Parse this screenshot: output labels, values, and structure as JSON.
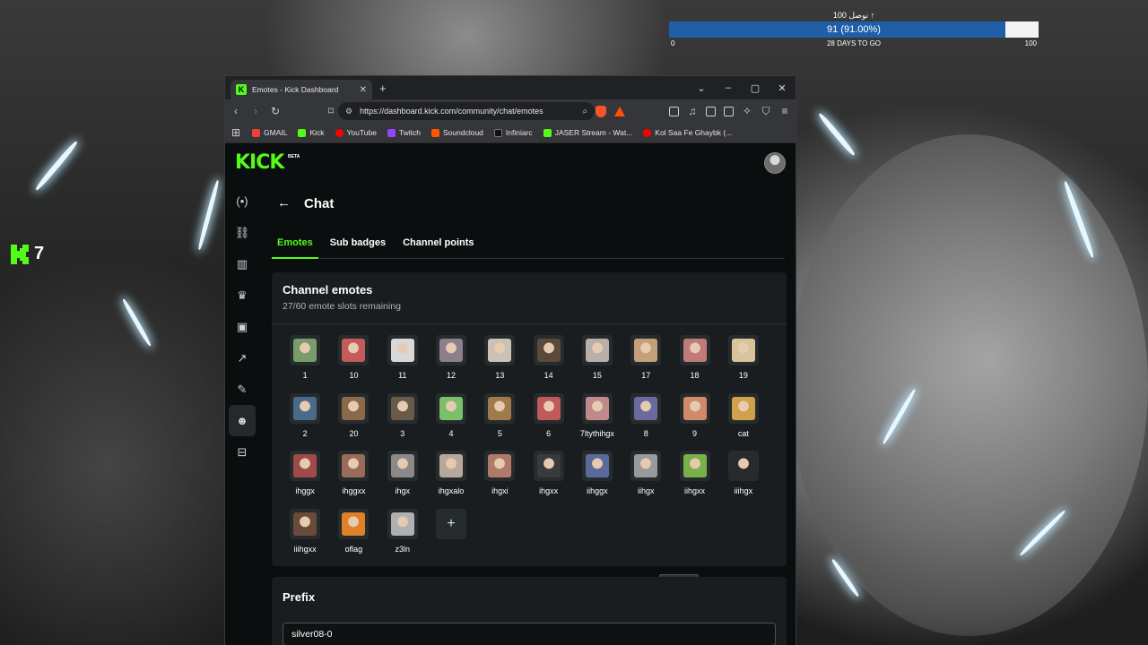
{
  "stream_overlay": {
    "goal": {
      "title": "نوصل 100 ↑",
      "progress_text": "91 (91.00%)",
      "progress_fraction": 0.91,
      "min_label": "0",
      "days_label": "28 DAYS TO GO",
      "max_label": "100",
      "fill_color": "#1f5fa8"
    },
    "kick_counter": "7"
  },
  "browser": {
    "tab": {
      "title": "Emotes - Kick Dashboard",
      "favicon": "kick-icon"
    },
    "window_controls": [
      "⌄",
      "–",
      "▢",
      "✕"
    ],
    "url": "https://dashboard.kick.com/community/chat/emotes",
    "bookmarks": [
      {
        "label": "GMAIL",
        "color": "#ea4335"
      },
      {
        "label": "Kick",
        "color": "#53fc18"
      },
      {
        "label": "YouTube",
        "color": "#ff0000"
      },
      {
        "label": "Twitch",
        "color": "#9146ff"
      },
      {
        "label": "Soundcloud",
        "color": "#ff5500"
      },
      {
        "label": "Infiniarc",
        "color": "#777777"
      },
      {
        "label": "JASER Stream - Wat...",
        "color": "#53fc18"
      },
      {
        "label": "Kol Saa Fe Ghaybk (...",
        "color": "#ff0000"
      }
    ]
  },
  "dashboard": {
    "brand": "KICK",
    "brand_badge": "BETA",
    "accent_color": "#53fc18",
    "sidebar_icons": [
      "live-icon",
      "link-icon",
      "analytics-icon",
      "trophy-icon",
      "video-icon",
      "stats-icon",
      "wrench-icon",
      "community-icon",
      "payout-icon"
    ],
    "page_title": "Chat",
    "tabs": [
      {
        "label": "Emotes",
        "active": true
      },
      {
        "label": "Sub badges",
        "active": false
      },
      {
        "label": "Channel points",
        "active": false
      }
    ],
    "emotes_card": {
      "title": "Channel emotes",
      "subtitle": "27/60 emote slots remaining",
      "emotes": [
        {
          "name": "1",
          "color": "#7a9c6a"
        },
        {
          "name": "10",
          "color": "#c45a5a"
        },
        {
          "name": "11",
          "color": "#d8d8d8"
        },
        {
          "name": "12",
          "color": "#8a7f8a"
        },
        {
          "name": "13",
          "color": "#c9c2b5"
        },
        {
          "name": "14",
          "color": "#5a4a3a"
        },
        {
          "name": "15",
          "color": "#b8b0a8"
        },
        {
          "name": "17",
          "color": "#c4a07a"
        },
        {
          "name": "18",
          "color": "#c07a7a"
        },
        {
          "name": "19",
          "color": "#d8c39a"
        },
        {
          "name": "2",
          "color": "#4a6a8a"
        },
        {
          "name": "20",
          "color": "#8a6a4a"
        },
        {
          "name": "3",
          "color": "#6a5a4a"
        },
        {
          "name": "4",
          "color": "#7ac06a"
        },
        {
          "name": "5",
          "color": "#a07a4a"
        },
        {
          "name": "6",
          "color": "#c05a5a"
        },
        {
          "name": "7ltythihgx",
          "color": "#c08a8a"
        },
        {
          "name": "8",
          "color": "#6a6aa0"
        },
        {
          "name": "9",
          "color": "#d08a6a"
        },
        {
          "name": "cat",
          "color": "#d0a04a"
        },
        {
          "name": "ihggx",
          "color": "#a04a4a"
        },
        {
          "name": "ihggxx",
          "color": "#9a6a5a"
        },
        {
          "name": "ihgx",
          "color": "#8a8a8a"
        },
        {
          "name": "ihgxalo",
          "color": "#b8a89a"
        },
        {
          "name": "ihgxi",
          "color": "#b07a6a"
        },
        {
          "name": "ihgxx",
          "color": "#3a3a3a"
        },
        {
          "name": "iihggx",
          "color": "#5a6a9a"
        },
        {
          "name": "iihgx",
          "color": "#9a9a9a"
        },
        {
          "name": "iihgxx",
          "color": "#7ab04a"
        },
        {
          "name": "iiihgx",
          "color": "#2a2a2a"
        },
        {
          "name": "iiihgxx",
          "color": "#6a4a3a"
        },
        {
          "name": "oflag",
          "color": "#e0802a"
        },
        {
          "name": "z3ln",
          "color": "#b0b0b0"
        }
      ],
      "add_label": "+",
      "tooltip": "7ltythihgx"
    },
    "prefix_card": {
      "title": "Prefix",
      "value": "silver08-0"
    }
  }
}
